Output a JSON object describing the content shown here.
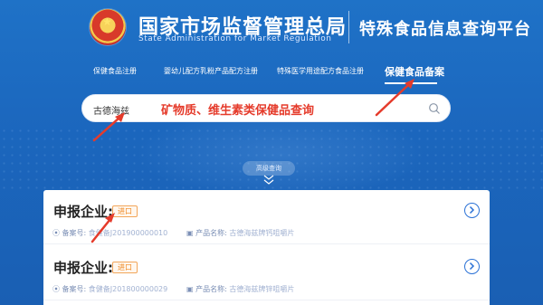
{
  "header": {
    "title_cn": "国家市场监督管理总局",
    "title_en": "State Administration  for  Market Regulation",
    "platform_name": "特殊食品信息查询平台"
  },
  "nav": {
    "items": [
      {
        "label": "保健食品注册",
        "active": false
      },
      {
        "label": "婴幼儿配方乳粉产品配方注册",
        "active": false
      },
      {
        "label": "特殊医学用途配方食品注册",
        "active": false
      },
      {
        "label": "保健食品备案",
        "active": true
      }
    ]
  },
  "search": {
    "value": "古德海兹",
    "icon": "search-icon"
  },
  "annotation": {
    "text": "矿物质、维生素类保健品查询",
    "color": "#e53b2b"
  },
  "advanced_search": {
    "label": "高级查询"
  },
  "results": [
    {
      "company_label": "申报企业:",
      "tag": "进口",
      "record_label": "备案号:",
      "record_value": "食健备J201900000010",
      "product_label": "产品名称:",
      "product_value": "古德海兹牌钙咀嚼片"
    },
    {
      "company_label": "申报企业:",
      "tag": "进口",
      "record_label": "备案号:",
      "record_value": "食健备J201800000029",
      "product_label": "产品名称:",
      "product_value": "古德海兹牌锌咀嚼片"
    }
  ],
  "colors": {
    "brand_blue": "#1a63b8",
    "accent_orange": "#f08a24",
    "link_blue": "#2a71d6"
  }
}
